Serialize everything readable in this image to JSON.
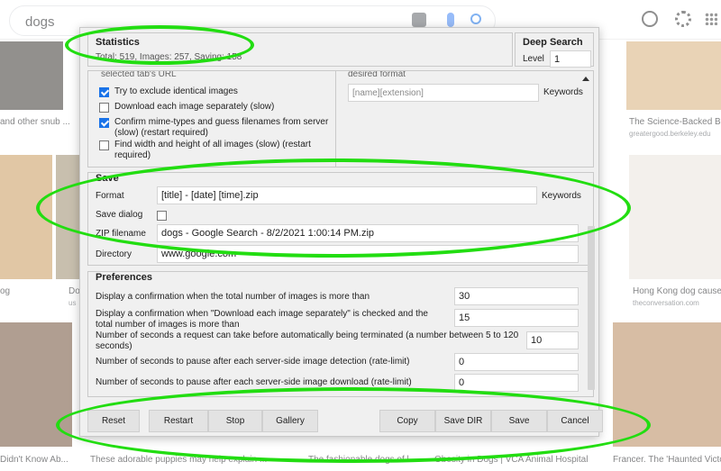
{
  "background": {
    "search_query": "dogs",
    "captions": {
      "left_top": "and other snub ...",
      "left_mid": "og",
      "left_mid2": "Do",
      "left_mid2_sub": "us",
      "left_bottom": "Didn't Know Ab...",
      "bottom_1": "These adorable puppies may help explain ...",
      "bottom_2": "The fashionable dogs of l...",
      "bottom_3": "Obesity in Dogs | VCA Animal Hospital",
      "bottom_4": "Francer. The 'Haunted Victor...",
      "right_top": "The Science-Backed Ber",
      "right_top_sub": "greatergood.berkeley.edu",
      "right_mid": "Hong Kong dog causes",
      "right_mid_sub": "theconversation.com"
    }
  },
  "statistics": {
    "title": "Statistics",
    "summary": "Total: 519, Images: 257, Saving: 158"
  },
  "deep_search": {
    "title": "Deep Search",
    "level_label": "Level",
    "level_value": "1"
  },
  "options": {
    "cut_top_left": "selected tab's URL",
    "cut_top_right": "desired format",
    "items": [
      {
        "label": "Try to exclude identical images",
        "checked": true
      },
      {
        "label": "Download each image separately (slow)",
        "checked": false
      },
      {
        "label": "Confirm mime-types and guess filenames from server (slow) (restart required)",
        "checked": true
      },
      {
        "label": "Find width and height of all images (slow) (restart required)",
        "checked": false
      }
    ],
    "name_format_value": "[name][extension]",
    "keywords_label": "Keywords"
  },
  "save": {
    "title": "Save",
    "format_label": "Format",
    "format_value": "[title] - [date] [time].zip",
    "keywords_label": "Keywords",
    "save_dialog_label": "Save dialog",
    "save_dialog_checked": false,
    "zip_label": "ZIP filename",
    "zip_value": "dogs - Google Search - 8/2/2021 1:00:14 PM.zip",
    "directory_label": "Directory",
    "directory_value": "www.google.com"
  },
  "preferences": {
    "title": "Preferences",
    "rows": [
      {
        "label": "Display a confirmation when the total number of images is more than",
        "value": "30"
      },
      {
        "label": "Display a confirmation when \"Download each image separately\" is checked and the total number of images is more than",
        "value": "15"
      },
      {
        "label": "Number of seconds a request can take before automatically being terminated (a number between 5 to 120 seconds)",
        "value": "10"
      },
      {
        "label": "Number of seconds to pause after each server-side image detection (rate-limit)",
        "value": "0"
      },
      {
        "label": "Number of seconds to pause after each server-side image download (rate-limit)",
        "value": "0"
      }
    ]
  },
  "buttons": {
    "reset": "Reset",
    "restart": "Restart",
    "stop": "Stop",
    "gallery": "Gallery",
    "copy": "Copy",
    "save_dir": "Save DIR",
    "save": "Save",
    "cancel": "Cancel"
  },
  "colors": {
    "annotation": "#22dd11",
    "checkbox_accent": "#1a73e8"
  }
}
